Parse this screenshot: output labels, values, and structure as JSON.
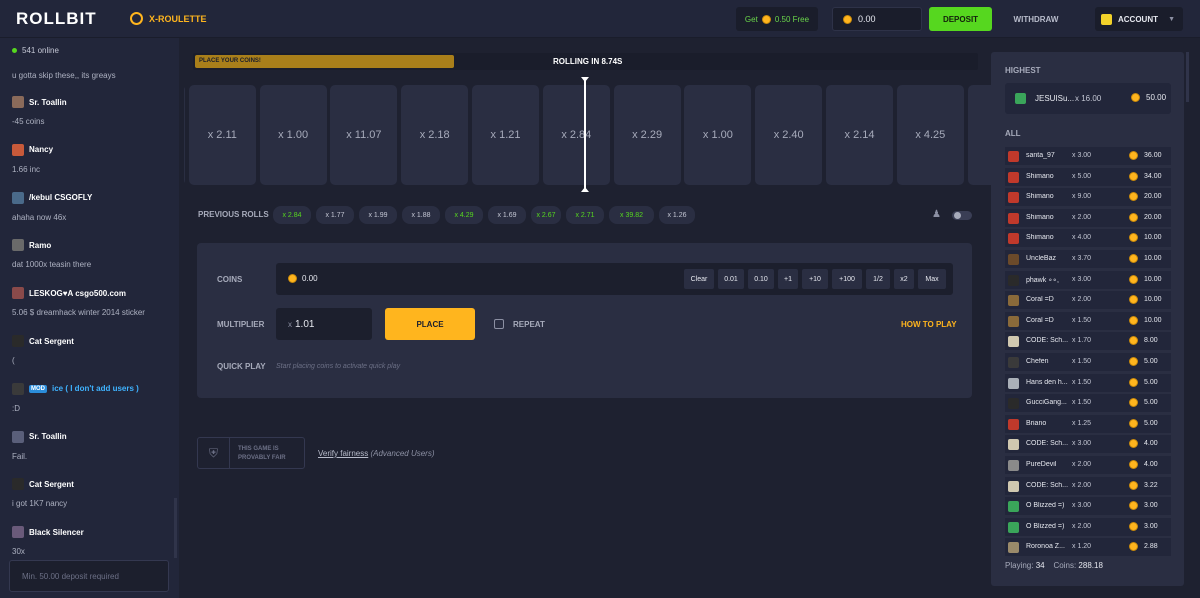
{
  "topbar": {
    "logo": "ROLLBIT",
    "game": "X-ROULETTE",
    "free": "0.50 Free",
    "free_prefix": "Get",
    "balance": "0.00",
    "deposit": "DEPOSIT",
    "withdraw": "WITHDRAW",
    "account": "ACCOUNT"
  },
  "chat": {
    "online": "541 online",
    "placeholder": "Min. 50.00 deposit required",
    "messages": [
      {
        "user": "",
        "text": "u gotta skip these,, its greays"
      },
      {
        "user": "Sr. Toallin",
        "text": "-45 coins"
      },
      {
        "user": "Nancy",
        "text": "1.66 inc"
      },
      {
        "user": "/kebul CSGOFLY",
        "text": "ahaha now 46x"
      },
      {
        "user": "Ramo",
        "text": "dat 1000x teasin there"
      },
      {
        "user": "LESKOG♥A csgo500.com",
        "text": "5.06 $ dreamhack winter 2014 sticker"
      },
      {
        "user": "Cat Sergent",
        "text": "("
      },
      {
        "user": "ice ( I don't add users )",
        "badge": "MOD",
        "text": ":D"
      },
      {
        "user": "Sr. Toallin",
        "text": "Fail."
      },
      {
        "user": "Cat Sergent",
        "text": "i got 1K7 nancy"
      },
      {
        "user": "Black Silencer",
        "text": "30x"
      }
    ]
  },
  "roll": {
    "bar_label": "PLACE YOUR COINS!",
    "rolling": "ROLLING IN 8.74S",
    "progress": 0.33,
    "tiles": [
      "",
      "x 2.11",
      "x 1.00",
      "x 11.07",
      "x 2.18",
      "x 1.21",
      "x 2.84",
      "x 2.29",
      "x 1.00",
      "x 2.40",
      "x 2.14",
      "x 4.25",
      ""
    ]
  },
  "previous": {
    "label": "PREVIOUS ROLLS",
    "rolls": [
      {
        "v": "x 2.84",
        "g": true
      },
      {
        "v": "x 1.77",
        "g": false
      },
      {
        "v": "x 1.99",
        "g": false
      },
      {
        "v": "x 1.88",
        "g": false
      },
      {
        "v": "x 4.29",
        "g": true
      },
      {
        "v": "x 1.69",
        "g": false
      },
      {
        "v": "x 2.67",
        "g": true
      },
      {
        "v": "x 2.71",
        "g": true
      },
      {
        "v": "x 39.82",
        "g": true
      },
      {
        "v": "x 1.26",
        "g": false
      }
    ]
  },
  "bet": {
    "coins_label": "COINS",
    "coins_value": "0.00",
    "quick": [
      "Clear",
      "0.01",
      "0.10",
      "+1",
      "+10",
      "+100",
      "1/2",
      "x2",
      "Max"
    ],
    "mult_label": "MULTIPLIER",
    "mult_x": "x",
    "mult_value": "1.01",
    "place": "PLACE",
    "repeat": "REPEAT",
    "how": "HOW TO PLAY",
    "quick_label": "QUICK PLAY",
    "quick_text": "Start placing coins to activate quick play"
  },
  "fair": {
    "line1": "THIS GAME IS",
    "line2": "PROVABLY FAIR",
    "verify": "Verify fairness",
    "adv": "(Advanced Users)"
  },
  "bets": {
    "highest_label": "HIGHEST",
    "highest": {
      "name": "JESUISu...",
      "mult": "x 16.00",
      "coins": "50.00"
    },
    "all_label": "ALL",
    "rows": [
      {
        "name": "santa_97",
        "mult": "x 3.00",
        "coins": "36.00"
      },
      {
        "name": "Shimano",
        "mult": "x 5.00",
        "coins": "34.00"
      },
      {
        "name": "Shimano",
        "mult": "x 9.00",
        "coins": "20.00"
      },
      {
        "name": "Shimano",
        "mult": "x 2.00",
        "coins": "20.00"
      },
      {
        "name": "Shimano",
        "mult": "x 4.00",
        "coins": "10.00"
      },
      {
        "name": "UncleBaz",
        "mult": "x 3.70",
        "coins": "10.00"
      },
      {
        "name": "phawk ∘∘,",
        "mult": "x 3.00",
        "coins": "10.00"
      },
      {
        "name": "Coral =D",
        "mult": "x 2.00",
        "coins": "10.00"
      },
      {
        "name": "Coral =D",
        "mult": "x 1.50",
        "coins": "10.00"
      },
      {
        "name": "CODE: Sch...",
        "mult": "x 1.70",
        "coins": "8.00"
      },
      {
        "name": "Chefen",
        "mult": "x 1.50",
        "coins": "5.00"
      },
      {
        "name": "Hans den h...",
        "mult": "x 1.50",
        "coins": "5.00"
      },
      {
        "name": "GucciGang...",
        "mult": "x 1.50",
        "coins": "5.00"
      },
      {
        "name": "Briano",
        "mult": "x 1.25",
        "coins": "5.00"
      },
      {
        "name": "CODE: Sch...",
        "mult": "x 3.00",
        "coins": "4.00"
      },
      {
        "name": "PureDevil",
        "mult": "x 2.00",
        "coins": "4.00"
      },
      {
        "name": "CODE: Sch...",
        "mult": "x 2.00",
        "coins": "3.22"
      },
      {
        "name": "O Blizzed =)",
        "mult": "x 3.00",
        "coins": "3.00"
      },
      {
        "name": "O Blizzed =)",
        "mult": "x 2.00",
        "coins": "3.00"
      },
      {
        "name": "Roronoa Z...",
        "mult": "x 1.20",
        "coins": "2.88"
      }
    ],
    "playing_label": "Playing:",
    "playing": "34",
    "coins_label": "Coins:",
    "coins": "288.18"
  },
  "colors": {
    "accent": "#ffb51e",
    "green": "#56d71f",
    "bg": "#1e2130"
  }
}
